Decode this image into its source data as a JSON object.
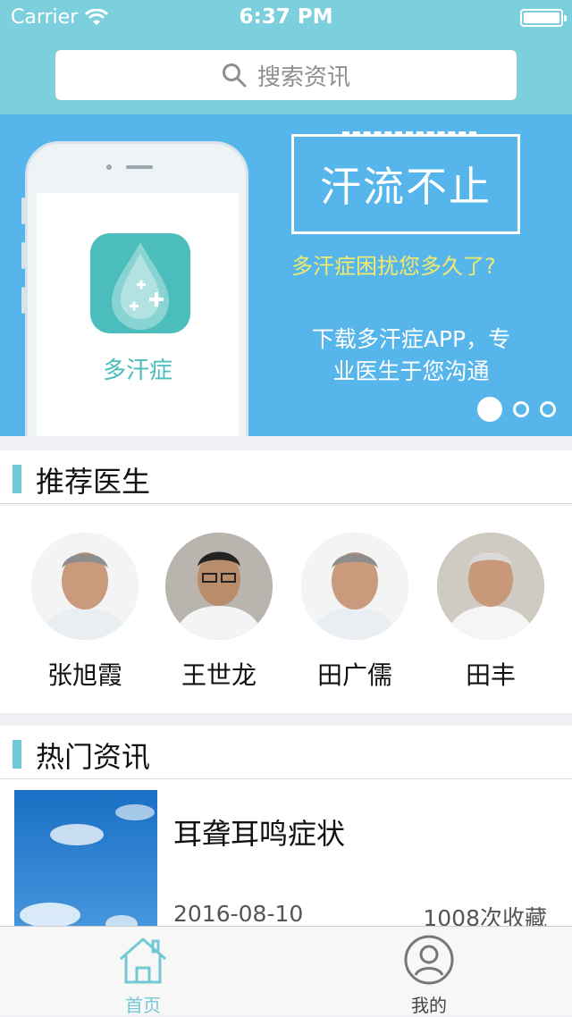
{
  "status_bar": {
    "carrier": "Carrier",
    "time": "6:37 PM"
  },
  "search": {
    "placeholder": "搜索资讯"
  },
  "banner": {
    "app_name": "多汗症",
    "headline": "汗流不止",
    "subtitle": "多汗症困扰您多久了?",
    "description_line1": "下载多汗症APP，专",
    "description_line2": "业医生于您沟通",
    "page_indicator": {
      "total": 3,
      "current": 1
    }
  },
  "doctors_section": {
    "title": "推荐医生",
    "doctors": [
      {
        "name": "张旭霞"
      },
      {
        "name": "王世龙"
      },
      {
        "name": "田广儒"
      },
      {
        "name": "田丰"
      }
    ]
  },
  "news_section": {
    "title": "热门资讯",
    "items": [
      {
        "title": "耳聋耳鸣症状",
        "date": "2016-08-10",
        "favorites": "1008次收藏"
      }
    ]
  },
  "tabbar": {
    "tabs": [
      {
        "label": "首页",
        "icon": "home-icon",
        "active": true
      },
      {
        "label": "我的",
        "icon": "profile-icon",
        "active": false
      }
    ]
  },
  "colors": {
    "header": "#7ccfdc",
    "banner": "#56b5ea",
    "accent": "#6ec9d8",
    "app_icon": "#4bbdbc",
    "subtitle": "#f2ea6b"
  }
}
